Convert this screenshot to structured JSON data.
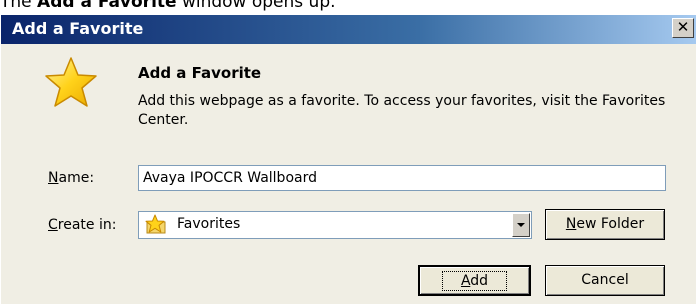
{
  "caption": {
    "prefix": "The ",
    "bold": "Add a Favorite",
    "suffix": " window opens up."
  },
  "window": {
    "title": "Add a Favorite",
    "close_glyph": "✕"
  },
  "header": {
    "heading": "Add a Favorite",
    "description": "Add this webpage as a favorite. To access your favorites, visit the Favorites Center.",
    "icon": "star-icon"
  },
  "form": {
    "name_label_key": "N",
    "name_label_rest": "ame:",
    "name_value": "Avaya IPOCCR Wallboard",
    "create_label_key": "C",
    "create_label_rest": "reate in:",
    "create_value": "Favorites",
    "create_icon": "folder-star-icon"
  },
  "buttons": {
    "new_folder_key": "N",
    "new_folder_rest": "ew Folder",
    "add_key": "A",
    "add_rest": "dd",
    "cancel": "Cancel"
  },
  "colors": {
    "titlebar_start": "#0a246a",
    "titlebar_end": "#a6caf0",
    "dialog_bg": "#f0eee4",
    "star": "#f7c200"
  }
}
